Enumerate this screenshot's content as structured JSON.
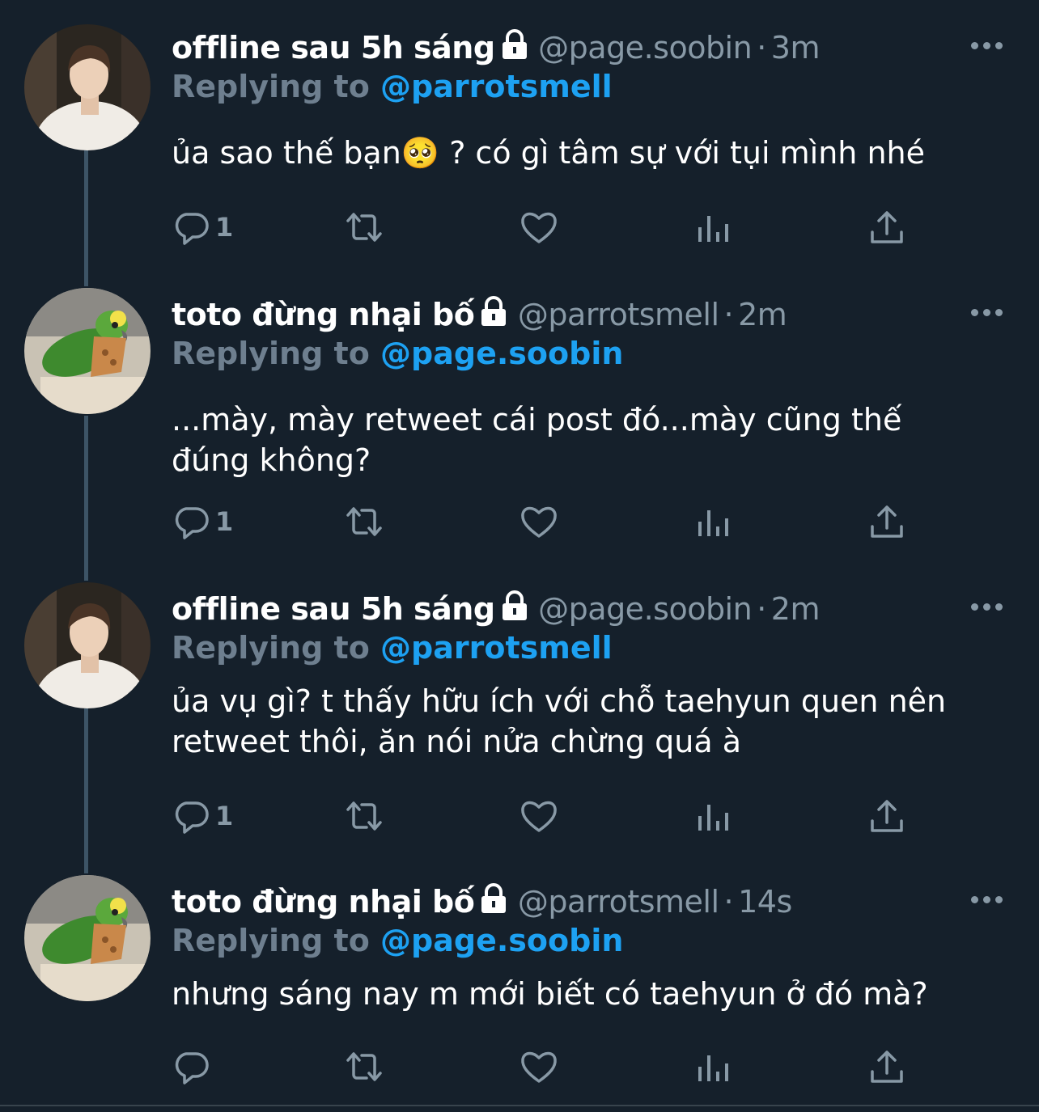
{
  "tweets": [
    {
      "name": "offline sau 5h sáng",
      "handle": "@page.soobin",
      "dot": "·",
      "time": "3m",
      "replying_label": "Replying to ",
      "replying_to": "@parrotsmell",
      "text": "ủa sao thế bạn🥺 ? có gì tâm sự với tụi mình nhé",
      "reply_count": "1",
      "avatar": "boy-avatar"
    },
    {
      "name": "toto đừng nhại bố",
      "handle": "@parrotsmell",
      "dot": "·",
      "time": "2m",
      "replying_label": "Replying to ",
      "replying_to": "@page.soobin",
      "text": "...mày, mày retweet cái post đó...mày cũng thế đúng không?",
      "reply_count": "1",
      "avatar": "parrot-avatar"
    },
    {
      "name": "offline sau 5h sáng",
      "handle": "@page.soobin",
      "dot": "·",
      "time": "2m",
      "replying_label": "Replying to ",
      "replying_to": "@parrotsmell",
      "text": "ủa vụ gì? t thấy hữu ích với chỗ taehyun quen nên retweet thôi, ăn nói nửa chừng quá à",
      "reply_count": "1",
      "avatar": "boy-avatar"
    },
    {
      "name": "toto đừng nhại bố",
      "handle": "@parrotsmell",
      "dot": "·",
      "time": "14s",
      "replying_label": "Replying to ",
      "replying_to": "@page.soobin",
      "text": "nhưng sáng nay m mới biết có taehyun ở đó mà?",
      "reply_count": "",
      "avatar": "parrot-avatar"
    }
  ],
  "icons": [
    "reply-icon",
    "retweet-icon",
    "like-icon",
    "analytics-icon",
    "share-icon",
    "more-icon",
    "lock-icon"
  ],
  "colors": {
    "background": "#15202b",
    "muted": "#8899a6",
    "accent": "#1da1f2",
    "text": "#ffffff"
  }
}
